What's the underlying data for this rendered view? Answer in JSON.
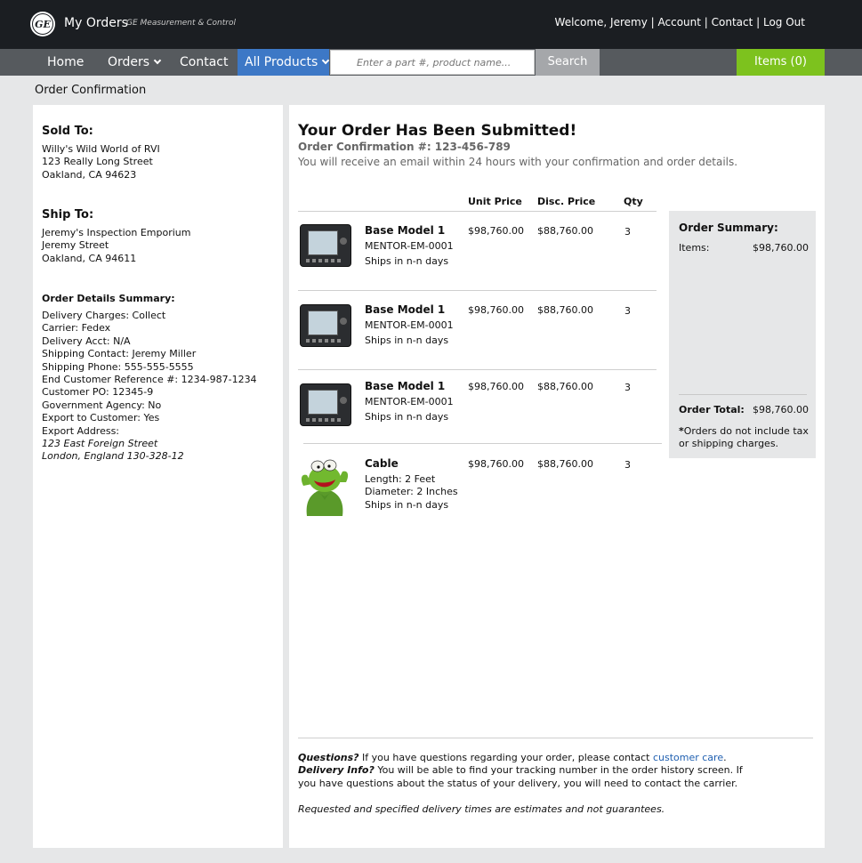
{
  "header": {
    "app_title": "My Orders",
    "subtitle": "GE Measurement & Control",
    "welcome": "Welcome, Jeremy",
    "account": "Account",
    "contact": "Contact",
    "logout": "Log Out"
  },
  "nav": {
    "home": "Home",
    "orders": "Orders",
    "contact": "Contact",
    "products": "All Products",
    "search_placeholder": "Enter a part #, product name...",
    "search": "Search",
    "cart": "Items (0)"
  },
  "page_title": "Order Confirmation",
  "sold_to": {
    "heading": "Sold To:",
    "lines": [
      "Willy's Wild World of RVI",
      "123 Really Long Street",
      "Oakland, CA 94623"
    ]
  },
  "ship_to": {
    "heading": "Ship To:",
    "lines": [
      "Jeremy's Inspection Emporium",
      "Jeremy Street",
      "Oakland, CA 94611"
    ]
  },
  "details": {
    "heading": "Order Details Summary:",
    "lines": [
      "Delivery Charges: Collect",
      "Carrier: Fedex",
      "Delivery Acct: N/A",
      "Shipping Contact: Jeremy Miller",
      "Shipping Phone: 555-555-5555",
      "End Customer Reference #: 1234-987-1234",
      "Customer PO: 12345-9",
      "Government Agency: No",
      "Export to Customer: Yes",
      "Export Address:"
    ],
    "export_lines": [
      "123 East Foreign Street",
      "London, England 130-328-12"
    ]
  },
  "main": {
    "title": "Your Order Has Been Submitted!",
    "confirmation": "Order Confirmation #: 123-456-789",
    "note": "You will receive an email within 24 hours with your confirmation and order details."
  },
  "table": {
    "headers": [
      "Unit Price",
      "Disc. Price",
      "Qty"
    ],
    "rows": [
      {
        "name": "Base Model 1",
        "line1": "MENTOR-EM-0001",
        "line2": "Ships in n-n days",
        "line3": "",
        "unit": "$98,760.00",
        "disc": "$88,760.00",
        "qty": "3",
        "image": "device"
      },
      {
        "name": "Base Model 1",
        "line1": "MENTOR-EM-0001",
        "line2": "Ships in n-n days",
        "line3": "",
        "unit": "$98,760.00",
        "disc": "$88,760.00",
        "qty": "3",
        "image": "device"
      },
      {
        "name": "Base Model 1",
        "line1": "MENTOR-EM-0001",
        "line2": "Ships in n-n days",
        "line3": "",
        "unit": "$98,760.00",
        "disc": "$88,760.00",
        "qty": "3",
        "image": "device"
      },
      {
        "name": "Cable",
        "line1": "Length: 2 Feet",
        "line2": "Diameter: 2 Inches",
        "line3": "Ships in n-n days",
        "unit": "$98,760.00",
        "disc": "$88,760.00",
        "qty": "3",
        "image": "frog"
      }
    ]
  },
  "summary": {
    "title": "Order Summary:",
    "items_label": "Items:",
    "items_value": "$98,760.00",
    "total_label": "Order Total:",
    "total_value": "$98,760.00",
    "note_star": "*",
    "note": "Orders do not include tax or shipping charges."
  },
  "footer": {
    "questions_label": "Questions?",
    "questions_text": " If you have questions regarding your order, please contact ",
    "questions_link": "customer care",
    "questions_end": ".",
    "delivery_label": "Delivery Info?",
    "delivery_text": " You will be able to find your tracking number in the order history screen. If you have questions about the status of your delivery, you will need to contact the carrier.",
    "disclaimer": "Requested and specified delivery times are estimates and not guarantees."
  }
}
